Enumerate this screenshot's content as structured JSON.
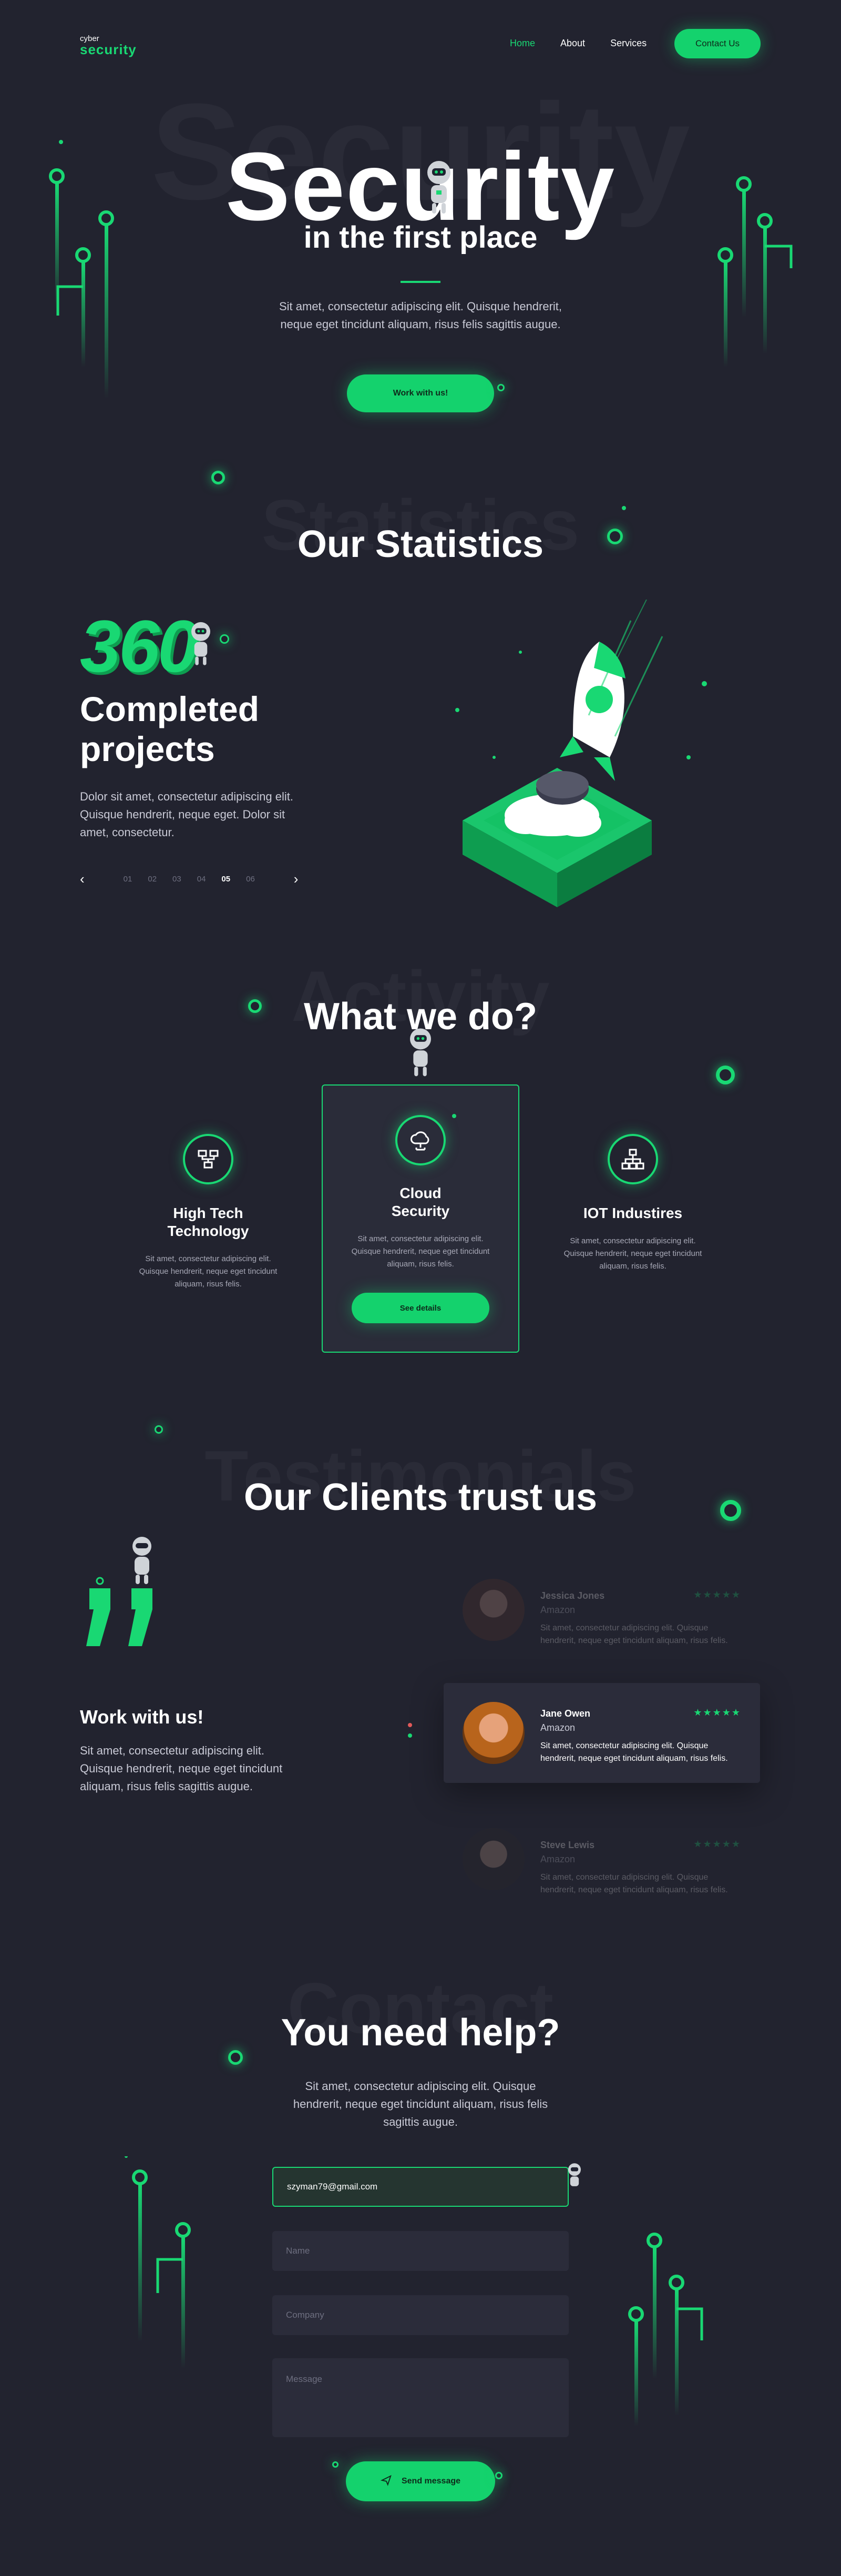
{
  "brand": {
    "line1": "cyber",
    "line2": "security"
  },
  "nav": {
    "home": "Home",
    "about": "About",
    "services": "Services",
    "contact": "Contact Us"
  },
  "hero": {
    "ghost": "Security",
    "title": "Security",
    "subtitle": "in the first place",
    "text": "Sit amet, consectetur adipiscing elit. Quisque hendrerit, neque eget tincidunt aliquam, risus felis sagittis augue.",
    "cta": "Work with us!"
  },
  "stats": {
    "ghost": "Statistics",
    "title": "Our Statistics",
    "number": "360",
    "label": "Completed projects",
    "text": "Dolor sit amet, consectetur adipiscing elit. Quisque hendrerit, neque eget. Dolor sit amet, consectetur.",
    "pages": [
      "01",
      "02",
      "03",
      "04",
      "05",
      "06"
    ],
    "active_page": "05"
  },
  "activity": {
    "ghost": "Activity",
    "title": "What we do?",
    "cards": [
      {
        "title": "High Tech Technology",
        "text": "Sit amet, consectetur adipiscing elit. Quisque hendrerit, neque eget tincidunt aliquam, risus felis.",
        "icon": "network-icon"
      },
      {
        "title": "Cloud Security",
        "text": "Sit amet, consectetur adipiscing elit. Quisque hendrerit, neque eget tincidunt aliquam, risus felis.",
        "button": "See details",
        "icon": "cloud-icon"
      },
      {
        "title": "IOT Industires",
        "text": "Sit amet, consectetur adipiscing elit. Quisque hendrerit, neque eget tincidunt aliquam, risus felis.",
        "icon": "hierarchy-icon"
      }
    ]
  },
  "testimonials": {
    "ghost": "Testimonials",
    "title": "Our Clients trust us",
    "side_title": "Work with us!",
    "side_text": "Sit amet, consectetur adipiscing elit. Quisque hendrerit, neque eget tincidunt aliquam, risus felis sagittis augue.",
    "items": [
      {
        "name": "Jessica Jones",
        "company": "Amazon",
        "text": "Sit amet, consectetur adipiscing elit. Quisque hendrerit, neque eget tincidunt aliquam, risus felis."
      },
      {
        "name": "Jane Owen",
        "company": "Amazon",
        "text": "Sit amet, consectetur adipiscing elit. Quisque hendrerit, neque eget tincidunt aliquam, risus felis."
      },
      {
        "name": "Steve Lewis",
        "company": "Amazon",
        "text": "Sit amet, consectetur adipiscing elit. Quisque hendrerit, neque eget tincidunt aliquam, risus felis."
      }
    ],
    "stars": "★★★★★"
  },
  "contact": {
    "ghost": "Contact",
    "title": "You need help?",
    "text": "Sit amet, consectetur adipiscing elit. Quisque hendrerit, neque eget tincidunt aliquam, risus felis sagittis augue.",
    "email_value": "szyman79@gmail.com",
    "name_placeholder": "Name",
    "company_placeholder": "Company",
    "message_placeholder": "Message",
    "send": "Send message"
  },
  "colors": {
    "accent": "#19d873",
    "background": "#22232f",
    "surface": "#2b2c3a"
  }
}
